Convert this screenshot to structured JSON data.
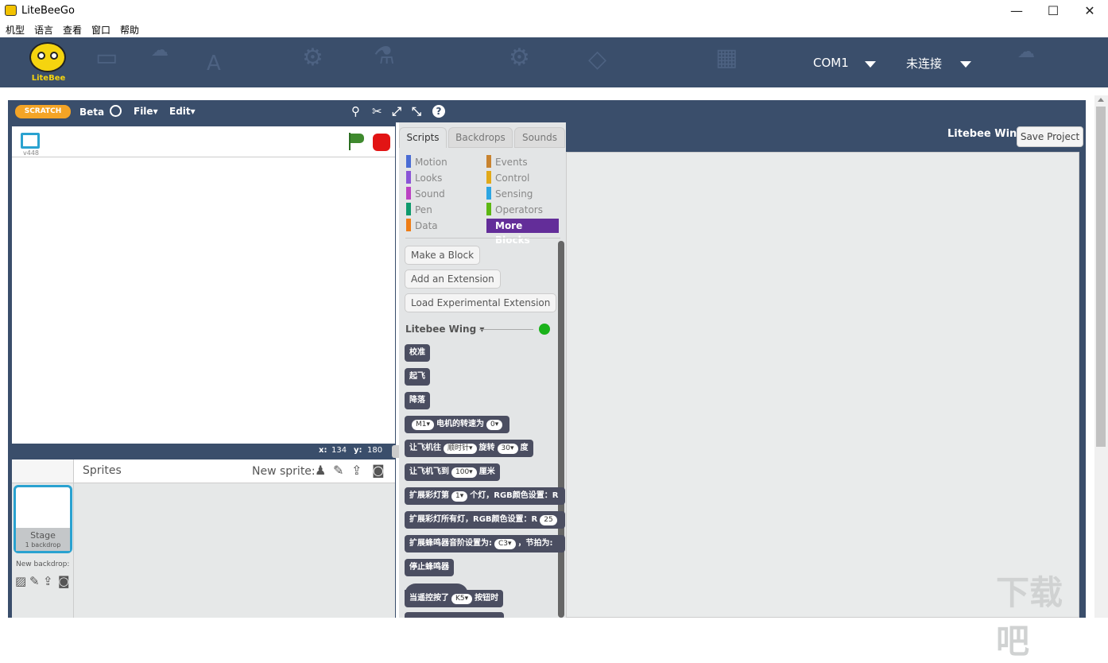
{
  "window": {
    "title": "LiteBeeGo",
    "minimize_glyph": "—",
    "maximize_glyph": "☐",
    "close_glyph": "✕"
  },
  "menubar": {
    "items": [
      "机型",
      "语言",
      "查看",
      "窗口",
      "帮助"
    ]
  },
  "header": {
    "logo_text": "LiteBee",
    "port": "COM1",
    "connection": "未连接"
  },
  "scratch_toolbar": {
    "logo_text": "SCRATCH",
    "version": "Beta",
    "file": "File▾",
    "edit": "Edit▾"
  },
  "stage": {
    "version": "v448",
    "x_label": "x:",
    "x_value": "134",
    "y_label": "y:",
    "y_value": "180"
  },
  "tabs": [
    "Scripts",
    "Backdrops",
    "Sounds"
  ],
  "categories_left": [
    {
      "label": "Motion",
      "color": "#4a6cd4"
    },
    {
      "label": "Looks",
      "color": "#8a55d7"
    },
    {
      "label": "Sound",
      "color": "#bb42c3"
    },
    {
      "label": "Pen",
      "color": "#0e9a6c"
    },
    {
      "label": "Data",
      "color": "#ee7d16"
    }
  ],
  "categories_right": [
    {
      "label": "Events",
      "color": "#c88330"
    },
    {
      "label": "Control",
      "color": "#e1a91a"
    },
    {
      "label": "Sensing",
      "color": "#2ca5e2"
    },
    {
      "label": "Operators",
      "color": "#5cb712"
    },
    {
      "label": "More Blocks",
      "color": "#632d99"
    }
  ],
  "palette_buttons": [
    "Make a Block",
    "Add an Extension",
    "Load Experimental Extension"
  ],
  "extension": {
    "name": "Litebee Wing ▾",
    "status_color": "#1ab21a"
  },
  "blocks": [
    {
      "text": "校准"
    },
    {
      "text": "起飞"
    },
    {
      "text": "降落"
    },
    {
      "pre": "",
      "pill1": "M1▾",
      "mid": "电机的转速为",
      "pill2": "0▾",
      "post": ""
    },
    {
      "pre": "让飞机往",
      "pill1": "顺时针▾",
      "mid": "旋转",
      "pill2": "30▾",
      "post": "度"
    },
    {
      "pre": "让飞机飞到",
      "pill1": "100▾",
      "mid": "厘米",
      "pill2": "",
      "post": ""
    },
    {
      "pre": "扩展彩灯第",
      "pill1": "1▾",
      "mid": "个灯，RGB颜色设置：R",
      "pill2": "",
      "post": ""
    },
    {
      "pre": "扩展彩灯所有灯，RGB颜色设置：R",
      "pill1": "25",
      "mid": "",
      "pill2": "",
      "post": ""
    },
    {
      "pre": "扩展蜂鸣器音阶设置为:",
      "pill1": "C3▾",
      "mid": "，节拍为:",
      "pill2": "",
      "post": ""
    },
    {
      "text": "停止蜂鸣器"
    },
    {
      "pre": "当遥控按了",
      "pill1": "K5▾",
      "mid": "按钮时",
      "pill2": "",
      "post": ""
    }
  ],
  "script_area": {
    "sprite_name": "Litebee Wing",
    "save_label": "Save Project"
  },
  "sprites": {
    "title": "Sprites",
    "new_sprite": "New sprite:",
    "stage_label": "Stage",
    "backdrop_count": "1 backdrop",
    "new_backdrop": "New backdrop:"
  },
  "watermark": {
    "text": "下载吧"
  }
}
